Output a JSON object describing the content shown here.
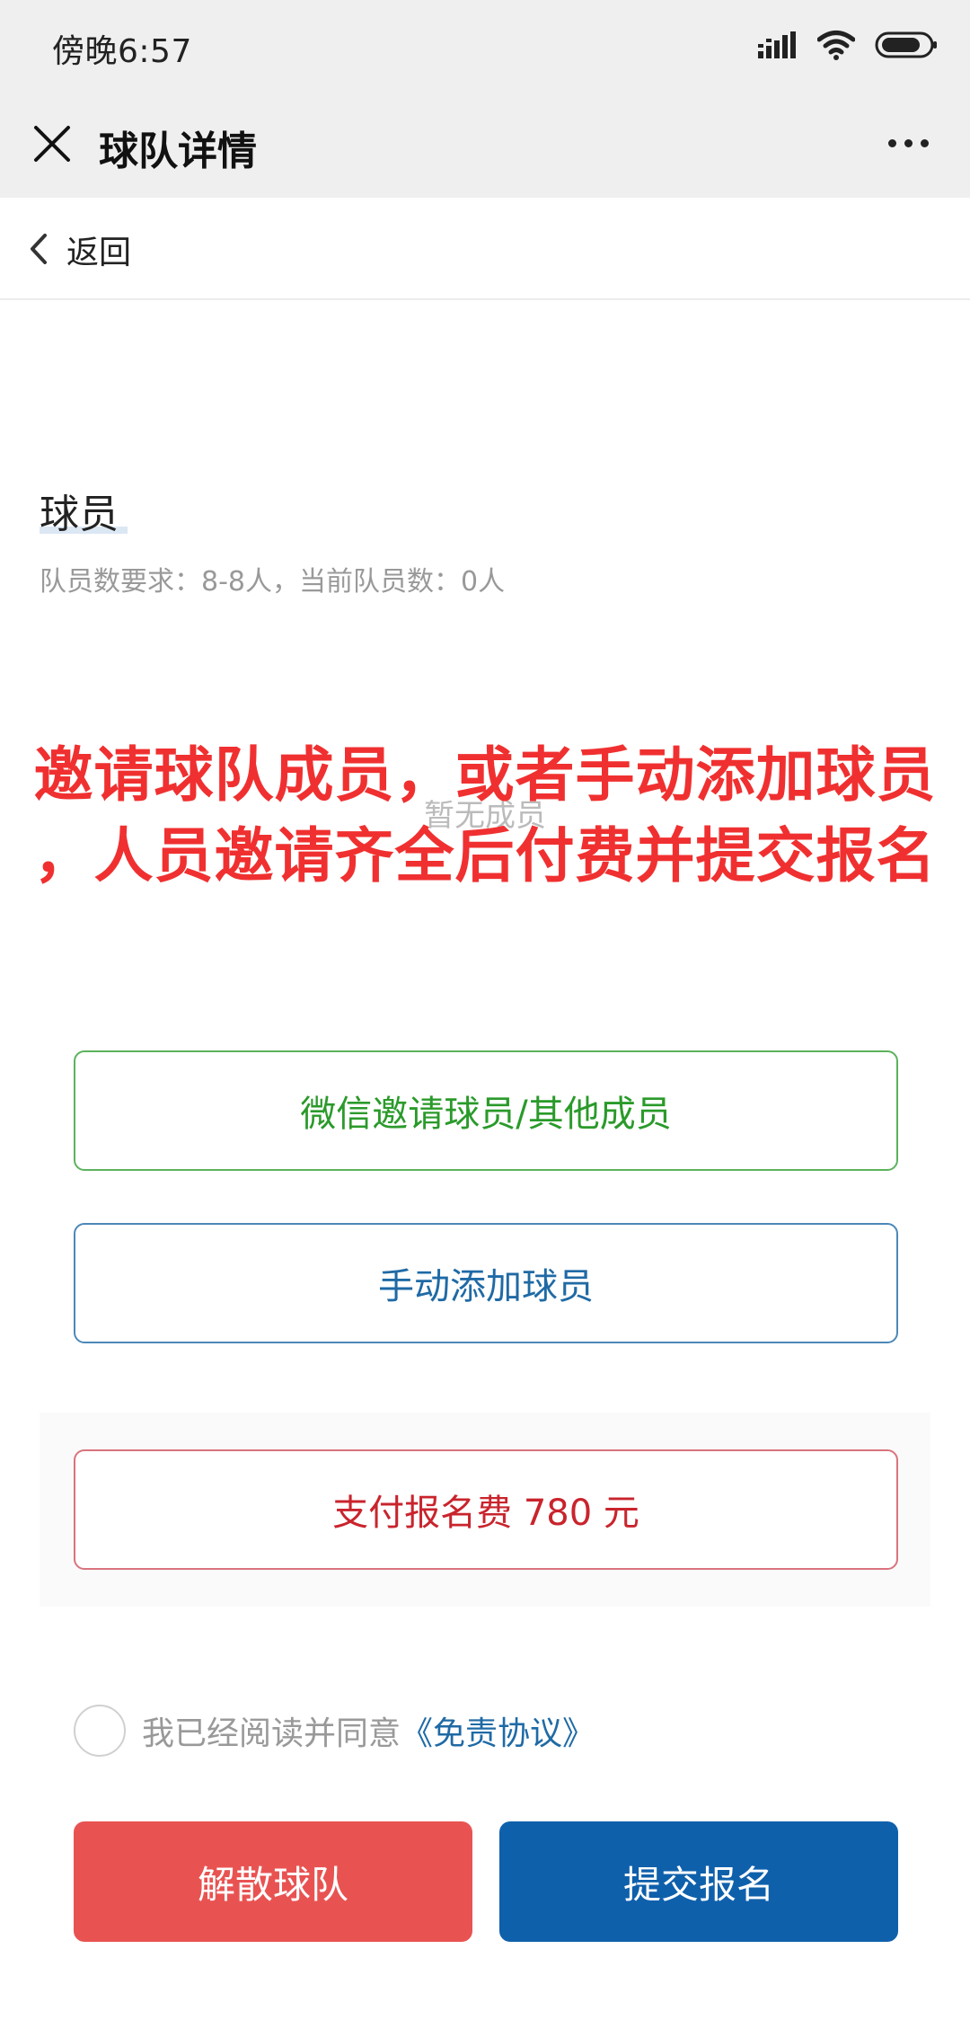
{
  "status_bar": {
    "time": "傍晚6:57"
  },
  "header": {
    "title": "球队详情"
  },
  "back_bar": {
    "label": "返回"
  },
  "players": {
    "title": "球员",
    "requirement": "队员数要求：8-8人，当前队员数：0人",
    "empty_text": "暂无成员"
  },
  "annotation": {
    "line1": "邀请球队成员，或者手动添加球员",
    "line2": "，人员邀请齐全后付费并提交报名",
    "color": "#f03030"
  },
  "buttons": {
    "wechat_invite": "微信邀请球员/其他成员",
    "manual_add": "手动添加球员",
    "pay_fee": "支付报名费 780 元",
    "disband": "解散球队",
    "submit": "提交报名"
  },
  "agreement": {
    "text": "我已经阅读并同意",
    "link": "《免责协议》"
  },
  "colors": {
    "header_bg": "#efefef",
    "green": "#2a9a2a",
    "blue": "#1f6aa5",
    "red": "#c9242d",
    "disband_bg": "#e85352",
    "submit_bg": "#0f60ab"
  }
}
